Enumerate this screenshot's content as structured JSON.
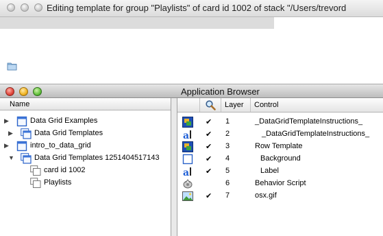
{
  "background_window": {
    "title": "Editing template for group \"Playlists\" of card id 1002 of stack \"/Users/trevord"
  },
  "app_browser": {
    "title": "Application Browser",
    "left_header": "Name",
    "tree": [
      {
        "label": "Data Grid Examples",
        "icon": "stack-icon",
        "expander": "collapsed"
      },
      {
        "label": "Data Grid Templates",
        "icon": "substack-icon",
        "expander": "collapsed"
      },
      {
        "label": "intro_to_data_grid",
        "icon": "stack-icon",
        "expander": "collapsed"
      },
      {
        "label": "Data Grid Templates 1251404517143",
        "icon": "substack-icon",
        "expander": "expanded"
      },
      {
        "label": "card id 1002",
        "icon": "card-icon",
        "expander": "none"
      },
      {
        "label": "Playlists",
        "icon": "card-icon",
        "expander": "none"
      }
    ],
    "columns": {
      "visible_icon": "magnifier-icon",
      "layer": "Layer",
      "control": "Control"
    },
    "controls": [
      {
        "icon": "group-icon",
        "visible": "✔",
        "layer": "1",
        "name": "_DataGridTemplateInstructions_"
      },
      {
        "icon": "field-icon",
        "visible": "✔",
        "layer": "2",
        "name": "_DataGridTemplateInstructions_"
      },
      {
        "icon": "group-icon",
        "visible": "✔",
        "layer": "3",
        "name": "Row Template"
      },
      {
        "icon": "graphic-icon",
        "visible": "✔",
        "layer": "4",
        "name": "Background"
      },
      {
        "icon": "field-icon",
        "visible": "✔",
        "layer": "5",
        "name": "Label"
      },
      {
        "icon": "behavior-script-icon",
        "visible": "",
        "layer": "6",
        "name": "Behavior Script"
      },
      {
        "icon": "image-icon",
        "visible": "✔",
        "layer": "7",
        "name": "osx.gif"
      }
    ]
  }
}
